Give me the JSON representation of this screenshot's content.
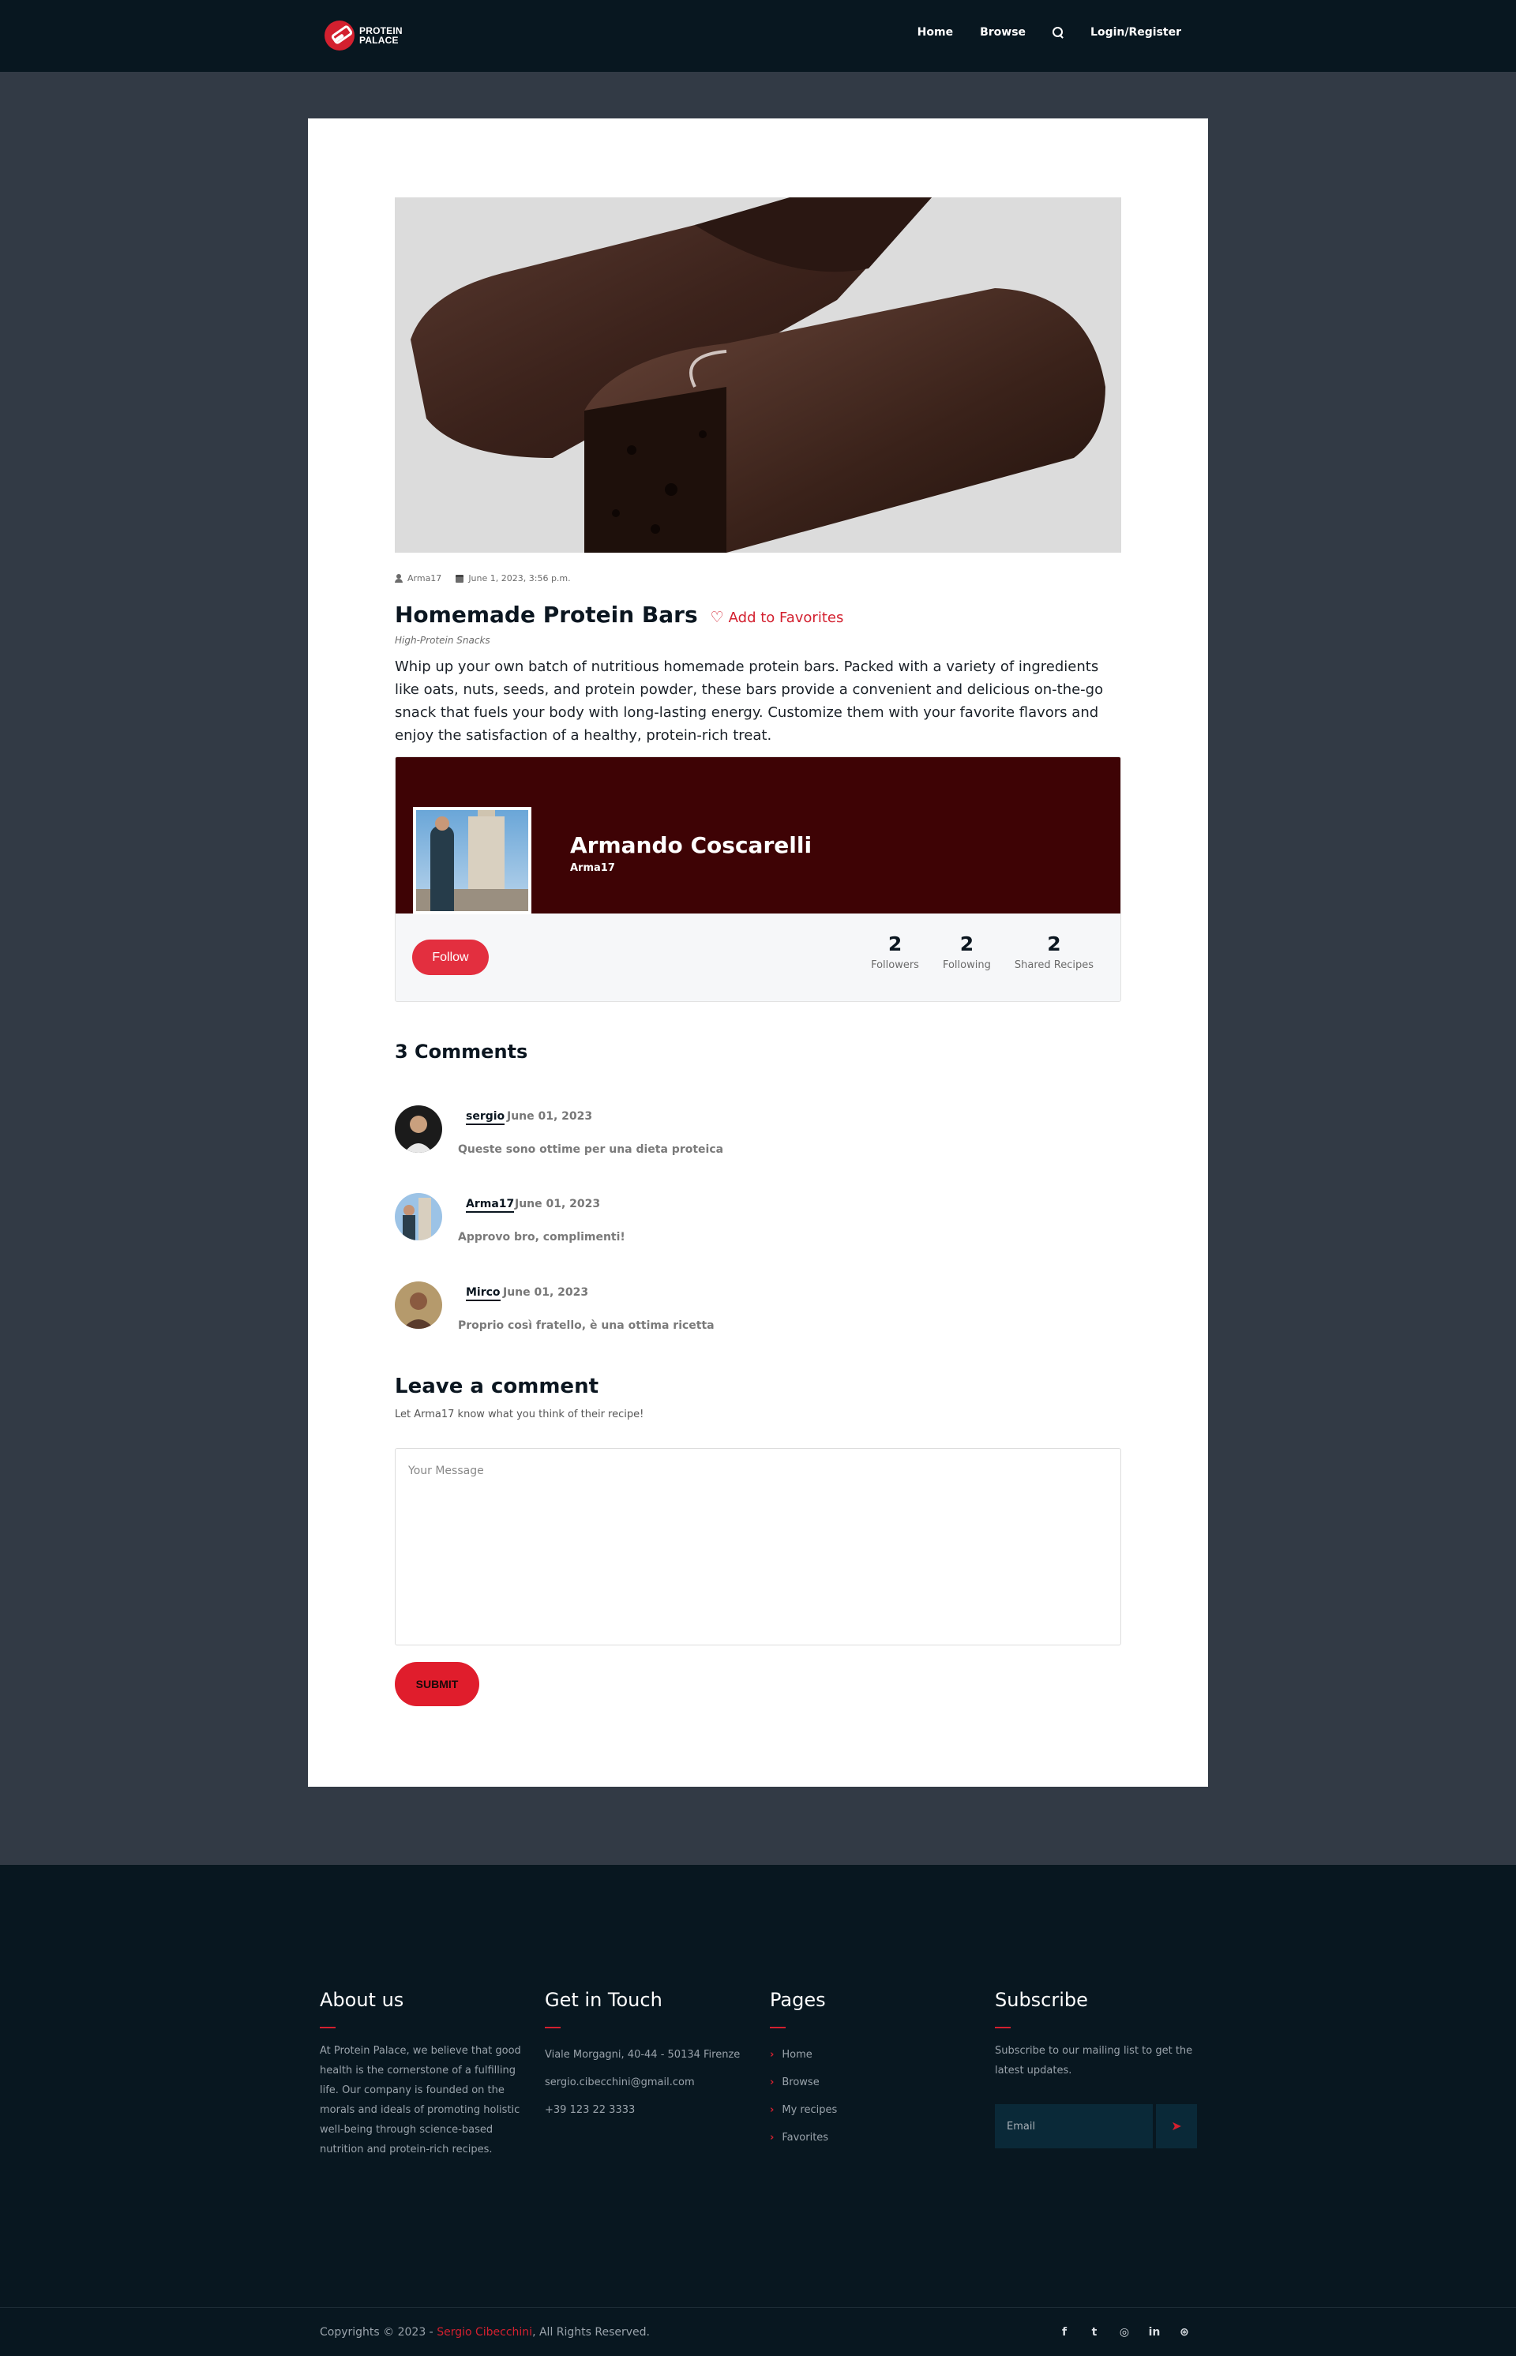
{
  "nav": {
    "brand_line1": "PROTEIN",
    "brand_line2": "PALACE",
    "links": [
      "Home",
      "Browse",
      "Login/Register"
    ]
  },
  "recipe": {
    "author": "Arma17",
    "date": "June 1, 2023, 3:56 p.m.",
    "title": "Homemade Protein Bars",
    "favorite_label": "Add to Favorites",
    "category": "High-Protein Snacks",
    "description": "Whip up your own batch of nutritious homemade protein bars. Packed with a variety of ingredients like oats, nuts, seeds, and protein powder, these bars provide a convenient and delicious on-the-go snack that fuels your body with long-lasting energy. Customize them with your favorite flavors and enjoy the satisfaction of a healthy, protein-rich treat."
  },
  "profile": {
    "name": "Armando Coscarelli",
    "handle": "Arma17",
    "follow_label": "Follow",
    "stats": [
      {
        "value": "2",
        "label": "Followers"
      },
      {
        "value": "2",
        "label": "Following"
      },
      {
        "value": "2",
        "label": "Shared Recipes"
      }
    ]
  },
  "comments": {
    "title": "3 Comments",
    "items": [
      {
        "author": "sergio",
        "date": "June 01, 2023",
        "text": "Queste sono ottime per una dieta proteica"
      },
      {
        "author": "Arma17",
        "date": "June 01, 2023",
        "text": "Approvo bro, complimenti!"
      },
      {
        "author": "Mirco",
        "date": "June 01, 2023",
        "text": "Proprio così fratello, è una ottima ricetta"
      }
    ]
  },
  "leave_comment": {
    "title": "Leave a comment",
    "subtitle": "Let Arma17 know what you think of their recipe!",
    "placeholder": "Your Message",
    "submit_label": "SUBMIT"
  },
  "footer": {
    "about_title": "About us",
    "about_text": "At Protein Palace, we believe that good health is the cornerstone of a fulfilling life. Our company is founded on the morals and ideals of promoting holistic well-being through science-based nutrition and protein-rich recipes.",
    "contact_title": "Get in Touch",
    "contact_items": [
      "Viale Morgagni, 40-44 - 50134 Firenze",
      "sergio.cibecchini@gmail.com",
      "+39 123 22 3333"
    ],
    "pages_title": "Pages",
    "pages_items": [
      "Home",
      "Browse",
      "My recipes",
      "Favorites"
    ],
    "subscribe_title": "Subscribe",
    "subscribe_text": "Subscribe to our mailing list to get the latest updates.",
    "email_placeholder": "Email",
    "copyright_prefix": "Copyrights © 2023 - ",
    "copyright_name": "Sergio Cibecchini",
    "copyright_suffix": ", All Rights Reserved.",
    "socials": [
      "facebook-icon",
      "twitter-icon",
      "instagram-icon",
      "linkedin-icon",
      "dribbble-icon"
    ]
  },
  "colors": {
    "accent": "#d3202f",
    "navbar": "#081720",
    "page_bg": "#323a45",
    "banner": "#3e0305"
  }
}
